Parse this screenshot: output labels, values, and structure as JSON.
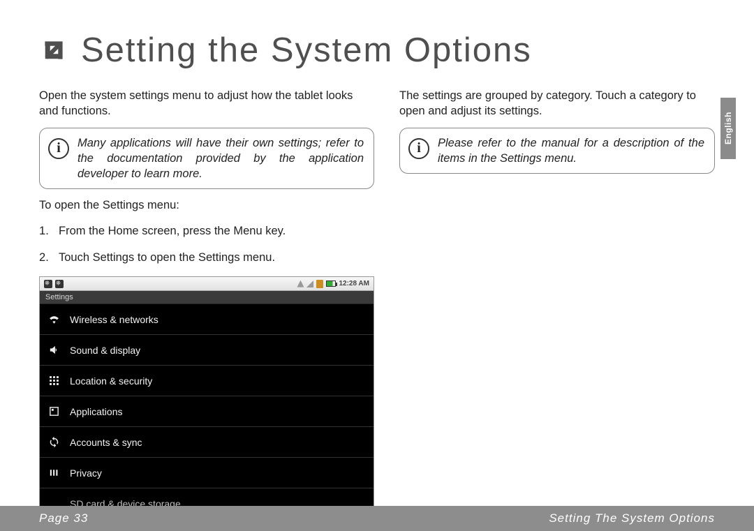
{
  "header": {
    "title": "Setting the System Options"
  },
  "left": {
    "intro": "Open the system settings menu to adjust how the tablet looks and functions.",
    "info": "Many applications will have their own settings; refer to the documentation provided by the ap­plication developer to learn more.",
    "list_intro": "To open the Settings menu:",
    "steps": [
      "From the Home screen, press the Menu key.",
      "Touch Settings to open the Settings menu."
    ]
  },
  "right": {
    "intro": "The settings are grouped by category. Touch a category to open and adjust its settings.",
    "info": "Please refer to the manual for a description of the items in the Settings menu."
  },
  "screenshot": {
    "time": "12:28 AM",
    "titlebar": "Settings",
    "items": [
      "Wireless & networks",
      "Sound & display",
      "Location & security",
      "Applications",
      "Accounts & sync",
      "Privacy",
      "SD card & device storage"
    ]
  },
  "lang_tab": "English",
  "footer": {
    "left": "Page 33",
    "right": "Setting The System Options"
  }
}
